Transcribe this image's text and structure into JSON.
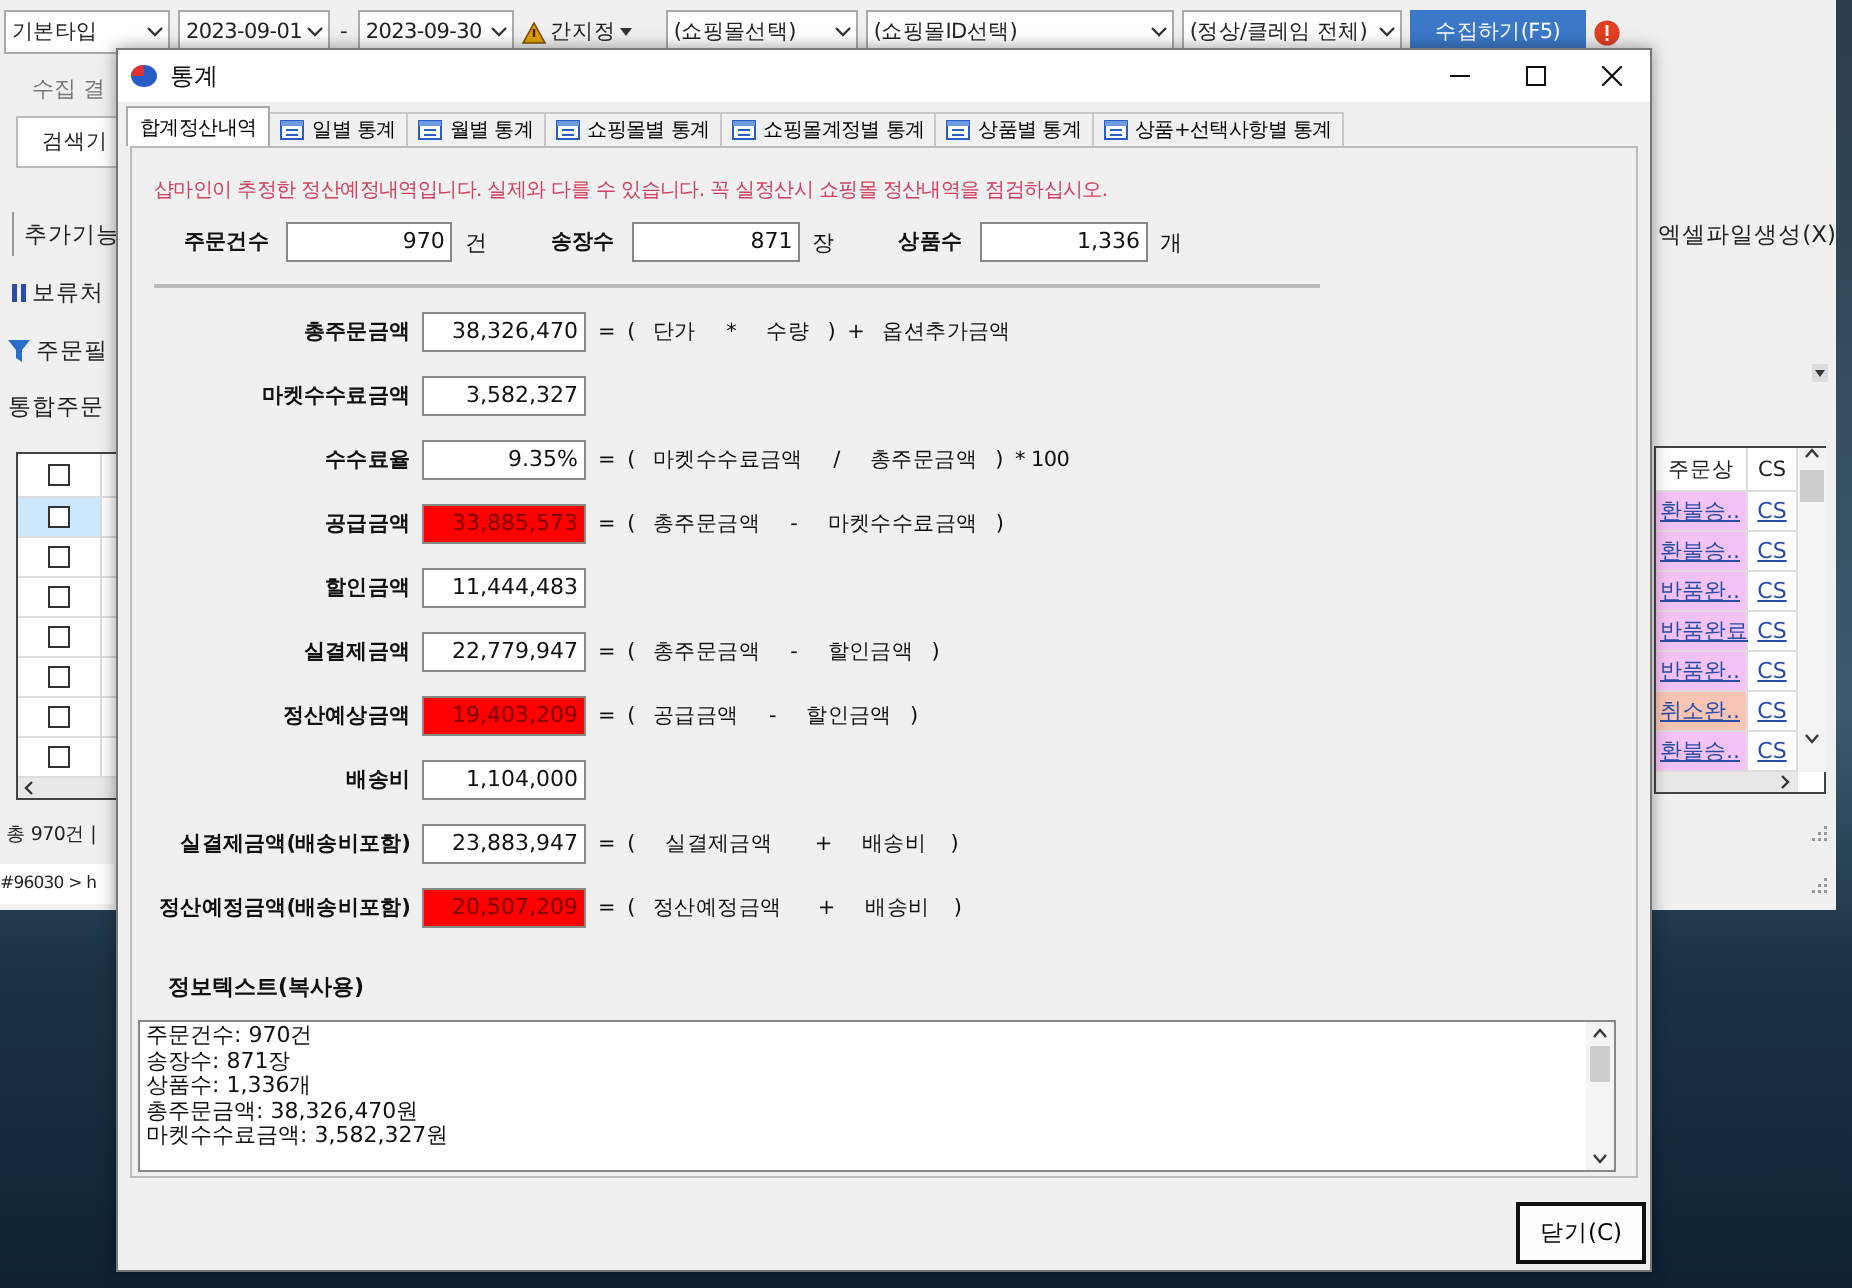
{
  "app": {
    "toolbar": {
      "type_select": "기본타입",
      "date_from": "2023-09-01",
      "date_separator": "-",
      "date_to": "2023-09-30",
      "time_setting": "간지정",
      "mall_select": "(쇼핑몰선택)",
      "mall_id_select": "(쇼핑몰ID선택)",
      "claim_select": "(정상/클레임 전체)",
      "collect_button": "수집하기(F5)"
    },
    "left_panel": {
      "group_title": "수집 결",
      "search_history": "검색기",
      "extra_functions": "추가기능",
      "hold_button": "보류처",
      "order_filter": "주문필",
      "order_management": "통합주문",
      "total": "총 970건 |",
      "path": "#96030 > h"
    },
    "export_button": "엑셀파일생성(X)",
    "order_table": {
      "columns": [
        "주문상",
        "CS"
      ],
      "header_checked": false,
      "rows": [
        {
          "selected": true,
          "checked": false,
          "status": "환불승..",
          "color": "#f4c2f4",
          "cs": "CS"
        },
        {
          "selected": false,
          "checked": false,
          "status": "환불승..",
          "color": "#f4c2f4",
          "cs": "CS"
        },
        {
          "selected": false,
          "checked": false,
          "status": "반품완..",
          "color": "#f4c2f4",
          "cs": "CS"
        },
        {
          "selected": false,
          "checked": false,
          "status": "반품완료",
          "color": "#f4c2f4",
          "cs": "CS"
        },
        {
          "selected": false,
          "checked": false,
          "status": "반품완..",
          "color": "#f4c2f4",
          "cs": "CS"
        },
        {
          "selected": false,
          "checked": false,
          "status": "취소완..",
          "color": "#f8c4b4",
          "cs": "CS"
        },
        {
          "selected": false,
          "checked": false,
          "status": "환불승..",
          "color": "#f4c2f4",
          "cs": "CS"
        }
      ]
    }
  },
  "dialog": {
    "title": "통계",
    "tabs": [
      {
        "label": "합계정산내역",
        "selected": true
      },
      {
        "label": "일별 통계",
        "selected": false
      },
      {
        "label": "월별 통계",
        "selected": false
      },
      {
        "label": "쇼핑몰별 통계",
        "selected": false
      },
      {
        "label": "쇼핑몰계정별 통계",
        "selected": false
      },
      {
        "label": "상품별 통계",
        "selected": false
      },
      {
        "label": "상품+선택사항별 통계",
        "selected": false
      }
    ],
    "notice": "샵마인이 추정한 정산예정내역입니다. 실제와 다를 수 있습니다. 꼭 실정산시 쇼핑몰 정산내역을 점검하십시오.",
    "counts": [
      {
        "label": "주문건수",
        "value": "970",
        "unit": "건"
      },
      {
        "label": "송장수",
        "value": "871",
        "unit": "장"
      },
      {
        "label": "상품수",
        "value": "1,336",
        "unit": "개"
      }
    ],
    "rows": [
      {
        "label": "총주문금액",
        "value": "38,326,470",
        "highlight": false,
        "formula": "=  (   단가     *     수량   )  +   옵션추가금액"
      },
      {
        "label": "마켓수수료금액",
        "value": "3,582,327",
        "highlight": false,
        "formula": ""
      },
      {
        "label": "수수료율",
        "value": "9.35%",
        "highlight": false,
        "formula": "=  (   마켓수수료금액     /     총주문금액   )  * 100"
      },
      {
        "label": "공급금액",
        "value": "33,885,573",
        "highlight": true,
        "formula": "=  (   총주문금액     -     마켓수수료금액   )"
      },
      {
        "label": "할인금액",
        "value": "11,444,483",
        "highlight": false,
        "formula": ""
      },
      {
        "label": "실결제금액",
        "value": "22,779,947",
        "highlight": false,
        "formula": "=  (   총주문금액     -     할인금액   )"
      },
      {
        "label": "정산예상금액",
        "value": "19,403,209",
        "highlight": true,
        "formula": "=  (   공급금액     -     할인금액   )"
      },
      {
        "label": "배송비",
        "value": "1,104,000",
        "highlight": false,
        "formula": ""
      },
      {
        "label": "실결제금액(배송비포함)",
        "value": "23,883,947",
        "highlight": false,
        "formula": "=  (     실결제금액       +     배송비    )"
      },
      {
        "label": "정산예정금액(배송비포함)",
        "value": "20,507,209",
        "highlight": true,
        "formula": "=  (   정산예정금액      +     배송비    )"
      }
    ],
    "info_label": "정보텍스트(복사용)",
    "info_lines": [
      "주문건수: 970건",
      "송장수: 871장",
      "상품수: 1,336개",
      "총주문금액: 38,326,470원",
      "마켓수수료금액: 3,582,327원"
    ],
    "close_button": "닫기(C)"
  }
}
